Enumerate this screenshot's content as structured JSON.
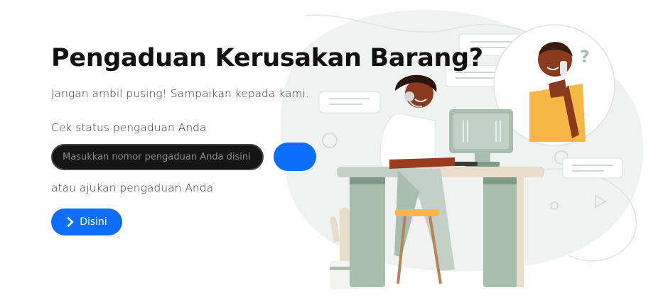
{
  "hero": {
    "title": "Pengaduan Kerusakan Barang?",
    "subtitle": "Jangan ambil pusing! Sampaikan kepada kami."
  },
  "status_check": {
    "label": "Cek status pengaduan Anda",
    "input_placeholder": "Masukkan nomor pengaduan Anda disini",
    "input_value": ""
  },
  "submit": {
    "label": "atau ajukan pengaduan Anda",
    "button_label": "Disini",
    "button_icon": "chevron-right-icon"
  },
  "colors": {
    "primary": "#0d6efd",
    "input_bg": "#151515",
    "illustration_green": "#a9bfad",
    "accent_orange": "#f5b942"
  }
}
